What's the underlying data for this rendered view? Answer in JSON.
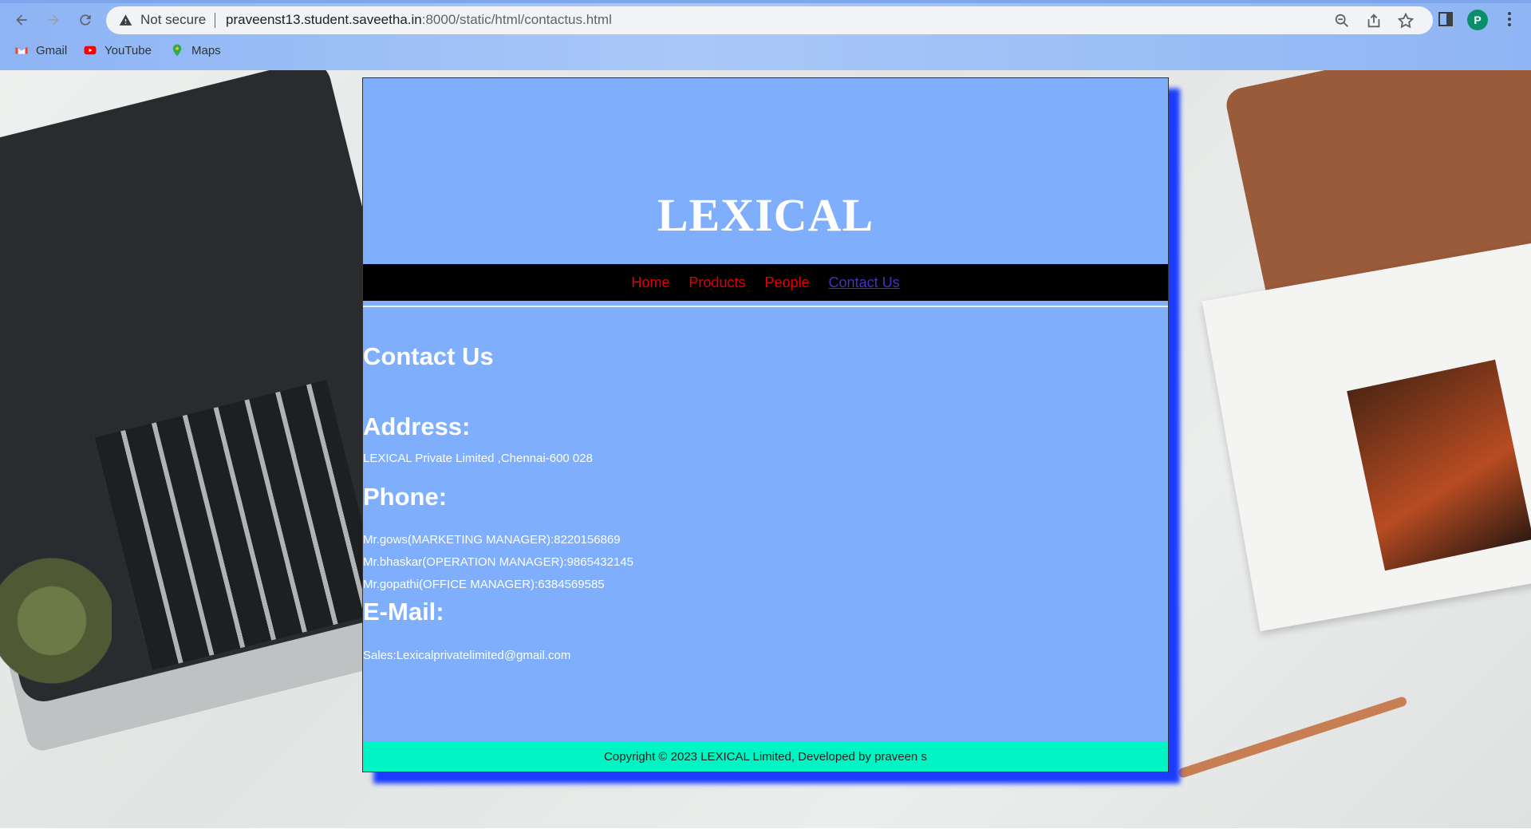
{
  "browser": {
    "security_label": "Not secure",
    "url_host": "praveenst13.student.saveetha.in",
    "url_path": ":8000/static/html/contactus.html",
    "avatar_letter": "P",
    "bookmarks": [
      {
        "label": "Gmail",
        "icon": "gmail-icon"
      },
      {
        "label": "YouTube",
        "icon": "youtube-icon"
      },
      {
        "label": "Maps",
        "icon": "maps-icon"
      }
    ]
  },
  "site": {
    "brand": "LEXICAL",
    "nav": [
      {
        "label": "Home",
        "active": false
      },
      {
        "label": "Products",
        "active": false
      },
      {
        "label": "People",
        "active": false
      },
      {
        "label": "Contact Us",
        "active": true
      }
    ],
    "page_title": "Contact Us",
    "address": {
      "heading": "Address:",
      "text": "LEXICAL Private Limited ,Chennai-600 028"
    },
    "phone": {
      "heading": "Phone:",
      "entries": [
        "Mr.gows(MARKETING MANAGER):8220156869",
        "Mr.bhaskar(OPERATION MANAGER):9865432145",
        "Mr.gopathi(OFFICE MANAGER):6384569585"
      ]
    },
    "email": {
      "heading": "E-Mail:",
      "text": "Sales:Lexicalprivatelimited@gmail.com"
    },
    "footer": "Copyright © 2023 LEXICAL Limited, Developed by praveen s",
    "colors": {
      "panel": "#7eaefc",
      "navbar": "#000000",
      "nav_link": "#e00000",
      "nav_active": "#4a2fc2",
      "footer": "#00f5c4",
      "shadow": "#1a3cff"
    }
  }
}
